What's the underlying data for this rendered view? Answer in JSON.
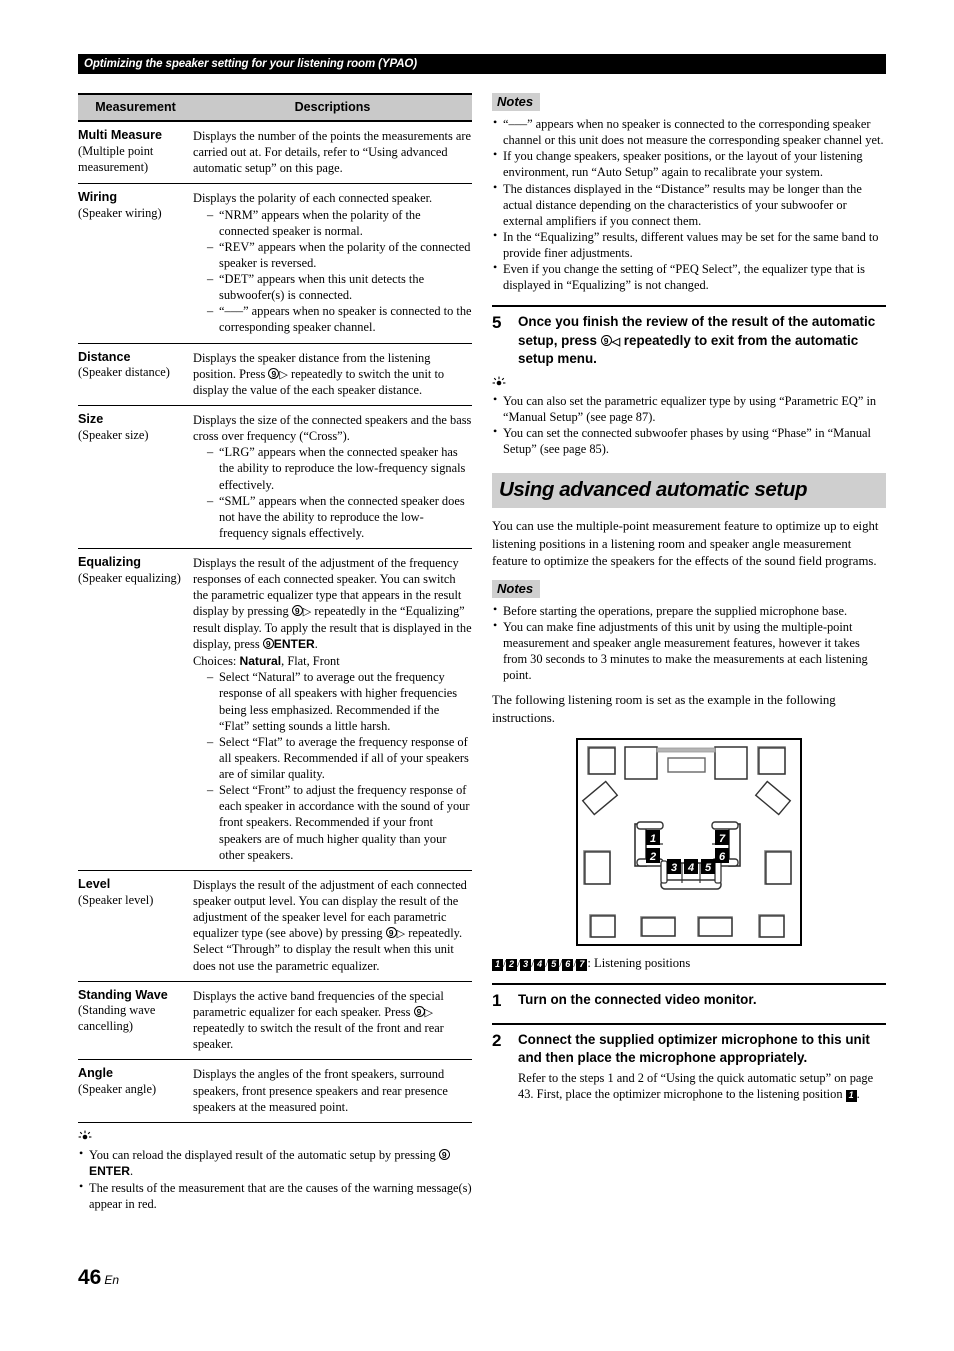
{
  "running_header": "Optimizing the speaker setting for your listening room (YPAO)",
  "table": {
    "headers": {
      "col1": "Measurement",
      "col2": "Descriptions"
    },
    "rows": [
      {
        "name": "Multi Measure",
        "sub": "(Multiple point measurement)",
        "desc": "Displays the number of the points the measurements are carried out at. For details, refer to “Using advanced automatic setup” on this page.",
        "items": []
      },
      {
        "name": "Wiring",
        "sub": "(Speaker wiring)",
        "desc": "Displays the polarity of each connected speaker.",
        "items": [
          "“NRM” appears when the polarity of the connected speaker is normal.",
          "“REV” appears when the polarity of the connected speaker is reversed.",
          "“DET” appears when this unit detects the subwoofer(s) is connected.",
          "“–––” appears when no speaker is connected to the corresponding speaker channel."
        ]
      },
      {
        "name": "Distance",
        "sub": "(Speaker distance)",
        "desc_pre": "Displays the speaker distance from the listening position. Press ",
        "desc_post": " repeatedly to switch the unit to display the value of the each speaker distance.",
        "items": []
      },
      {
        "name": "Size",
        "sub": "(Speaker size)",
        "desc": "Displays the size of the connected speakers and the bass cross over frequency (“Cross”).",
        "items": [
          "“LRG” appears when the connected speaker has the ability to reproduce the low-frequency signals effectively.",
          "“SML” appears when the connected speaker does not have the ability to reproduce the low-frequency signals effectively."
        ]
      },
      {
        "name": "Equalizing",
        "sub": "(Speaker equalizing)",
        "desc_pre": "Displays the result of the adjustment of the frequency responses of each connected speaker. You can switch the parametric equalizer type that appears in the result display by pressing ",
        "desc_mid": " repeatedly in the “Equalizing” result display. To apply the result that is displayed in the display, press ",
        "enter_label": "ENTER",
        "desc_post": ".",
        "choices_label": "Choices: ",
        "choice_default": "Natural",
        "choices_rest": ", Flat, Front",
        "items": [
          "Select “Natural” to average out the frequency response of all speakers with higher frequencies being less emphasized. Recommended if the “Flat” setting sounds a little harsh.",
          "Select “Flat” to average the frequency response of all speakers. Recommended if all of your speakers are of similar quality.",
          "Select “Front” to adjust the frequency response of each speaker in accordance with the sound of your front speakers. Recommended if your front speakers are of much higher quality than your other speakers."
        ]
      },
      {
        "name": "Level",
        "sub": "(Speaker level)",
        "desc_pre": "Displays the result of the adjustment of each connected speaker output level. You can display the result of the adjustment of the speaker level for each parametric equalizer type (see above) by pressing ",
        "desc_post": " repeatedly. Select “Through” to display the result when this unit does not use the parametric equalizer.",
        "items": []
      },
      {
        "name": "Standing Wave",
        "sub": "(Standing wave cancelling)",
        "desc_pre": "Displays the active band frequencies of the special parametric equalizer for each speaker. Press ",
        "desc_post": " repeatedly to switch the result of the front and rear speaker.",
        "items": []
      },
      {
        "name": "Angle",
        "sub": "(Speaker angle)",
        "desc": "Displays the angles of the front speakers, surround speakers, front presence speakers and rear presence speakers at the measured point.",
        "items": []
      }
    ]
  },
  "left_tip": {
    "bullet1_pre": "You can reload the displayed result of the automatic setup by pressing ",
    "bullet1_enter": "ENTER",
    "bullet1_post": ".",
    "bullet2": "The results of the measurement that are the causes of the warning message(s) appear in red."
  },
  "notes_top": {
    "label": "Notes",
    "items": [
      "“–––” appears when no speaker is connected to the corresponding speaker channel or this unit does not measure the corresponding speaker channel yet.",
      "If you change speakers, speaker positions, or the layout of your listening environment, run “Auto Setup” again to recalibrate your system.",
      "The distances displayed in the “Distance” results may be longer than the actual distance depending on the characteristics of your subwoofer or external amplifiers if you connect them.",
      "In the “Equalizing” results, different values may be set for the same band to provide finer adjustments.",
      "Even if you change the setting of “PEQ Select”, the equalizer type that is displayed in “Equalizing” is not changed."
    ]
  },
  "step5": {
    "num": "5",
    "title_pre": "Once you finish the review of the result of the automatic setup, press ",
    "title_post": " repeatedly to exit from the automatic setup menu.",
    "tips": [
      "You can also set the parametric equalizer type by using “Parametric EQ” in “Manual Setup” (see page 87).",
      "You can set the connected subwoofer phases by using “Phase” in “Manual Setup” (see page 85)."
    ]
  },
  "section": {
    "heading": "Using advanced automatic setup",
    "intro": "You can use the multiple-point measurement feature to optimize up to eight listening positions in a listening room and speaker angle measurement feature to optimize the speakers for the effects of the sound field programs.",
    "notes_label": "Notes",
    "notes": [
      "Before starting the operations, prepare the supplied microphone base.",
      "You can make fine adjustments of this unit by using the multiple-point measurement and speaker angle measurement features, however it takes from 30 seconds to 3 minutes to make the measurements at each listening point."
    ],
    "after_notes": "The following listening room is set as the example in the following instructions."
  },
  "diagram": {
    "positions": [
      "1",
      "2",
      "3",
      "4",
      "5",
      "6",
      "7"
    ],
    "legend_suffix": ": Listening positions"
  },
  "step1": {
    "num": "1",
    "title": "Turn on the connected video monitor."
  },
  "step2": {
    "num": "2",
    "title": "Connect the supplied optimizer microphone to this unit and then place the microphone appropriately.",
    "desc_pre": "Refer to the steps 1 and 2 of “Using the quick automatic setup” on page 43. First, place the optimizer microphone to the listening position ",
    "desc_chip": "1",
    "desc_post": "."
  },
  "footer": {
    "page": "46",
    "lang": "En"
  },
  "glyphs": {
    "circle_nine": "9",
    "triangle_right": "▷",
    "triangle_left": "◁",
    "bulb": "☀"
  }
}
